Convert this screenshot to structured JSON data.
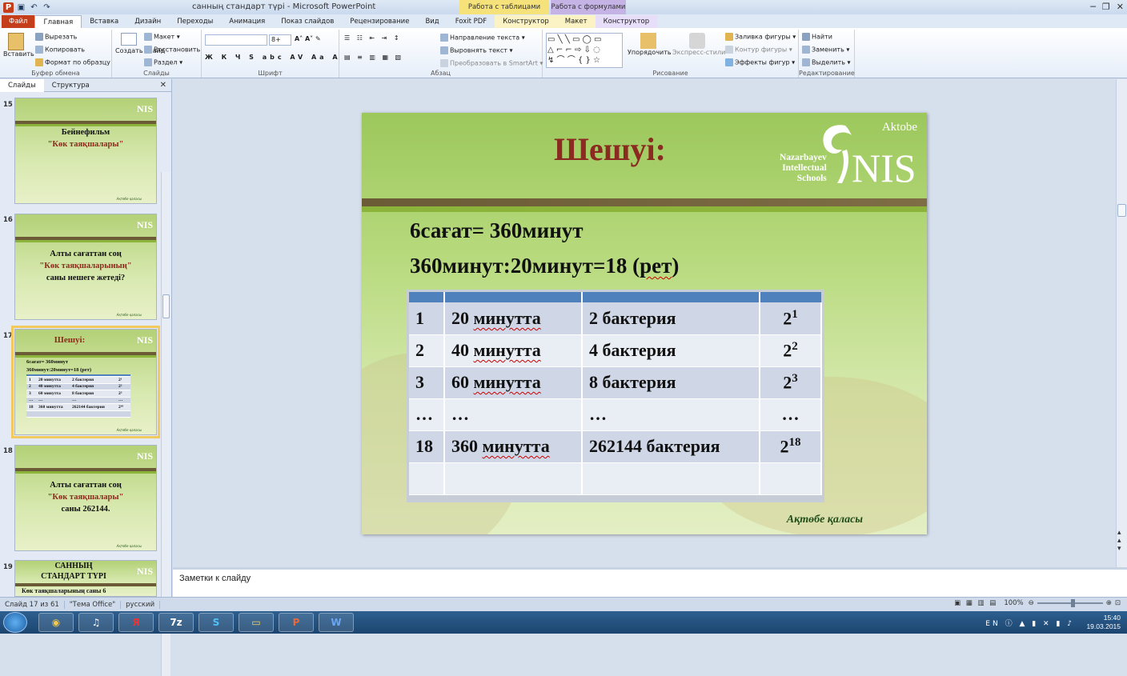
{
  "window": {
    "title": "санның стандарт түрі - Microsoft PowerPoint",
    "context_tab_1": "Работа с таблицами",
    "context_tab_2": "Работа с формулами"
  },
  "ribbon_tabs": [
    "Файл",
    "Главная",
    "Вставка",
    "Дизайн",
    "Переходы",
    "Анимация",
    "Показ слайдов",
    "Рецензирование",
    "Вид",
    "Foxit PDF",
    "Конструктор",
    "Макет",
    "Конструктор"
  ],
  "ribbon": {
    "clipboard": {
      "paste": "Вставить",
      "cut": "Вырезать",
      "copy": "Копировать",
      "format": "Формат по образцу",
      "label": "Буфер обмена"
    },
    "slides": {
      "new": "Создать слайд",
      "layout": "Макет",
      "reset": "Восстановить",
      "section": "Раздел",
      "label": "Слайды"
    },
    "font": {
      "size": "8+",
      "label": "Шрифт"
    },
    "paragraph": {
      "dir": "Направление текста",
      "align": "Выровнять текст",
      "smartart": "Преобразовать в SmartArt",
      "label": "Абзац"
    },
    "drawing": {
      "arrange": "Упорядочить",
      "styles": "Экспресс-стили",
      "fill": "Заливка фигуры",
      "outline": "Контур фигуры",
      "effects": "Эффекты фигур",
      "label": "Рисование"
    },
    "editing": {
      "find": "Найти",
      "replace": "Заменить",
      "select": "Выделить",
      "label": "Редактирование"
    }
  },
  "left_panel": {
    "tab_slides": "Слайды",
    "tab_outline": "Структура",
    "thumbs": [
      {
        "num": "15",
        "lines": [
          "Бейнефильм",
          "\"Көк таяқшалары\""
        ]
      },
      {
        "num": "16",
        "lines": [
          "Алты сағаттан соң",
          "\"Көк таяқшаларының\"",
          "саны нешеге жетеді?"
        ]
      },
      {
        "num": "17",
        "title": "Шешуі:"
      },
      {
        "num": "18",
        "lines": [
          "Алты сағаттан соң",
          "\"Көк таяқшалары\"",
          "саны  262144."
        ]
      },
      {
        "num": "19",
        "lines": [
          "САННЫҢ",
          "СТАНДАРТ  ТҮРІ",
          "Көк  таяқшаларының   саны  6"
        ]
      }
    ]
  },
  "slide": {
    "aktobe": "Aktobe",
    "title": "Шешуі:",
    "nis_words": [
      "Nazarbayev",
      "Intellectual",
      "Schools"
    ],
    "nis_logo": "NIS",
    "line1": "6сағат= 360минут",
    "line2_a": "360минут:20минут=18 (",
    "line2_b": "рет",
    "line2_c": ")",
    "table": [
      {
        "n": "1",
        "a": "20 ",
        "aw": "минутта",
        "b": "2 бактерия",
        "base": "2",
        "exp": "1"
      },
      {
        "n": "2",
        "a": "40 ",
        "aw": "минутта",
        "b": "4 бактерия",
        "base": "2",
        "exp": "2"
      },
      {
        "n": "3",
        "a": "60 ",
        "aw": "минутта",
        "b": "8 бактерия",
        "base": "2",
        "exp": "3"
      },
      {
        "n": "…",
        "a": "…",
        "aw": "",
        "b": "…",
        "base": "…",
        "exp": ""
      },
      {
        "n": "18",
        "a": "360 ",
        "aw": "минутта",
        "b": "262144 бактерия",
        "base": "2",
        "exp": "18"
      },
      {
        "n": "",
        "a": "",
        "aw": "",
        "b": "",
        "base": "",
        "exp": ""
      }
    ],
    "footer": "Ақтөбе қаласы",
    "thumb_mini": {
      "line1": "6сағат= 360минут",
      "line2": "360минут:20минут=18 (рет)",
      "rows": [
        [
          "1",
          "20 минутта",
          "2 бактерия",
          "2¹"
        ],
        [
          "2",
          "40 минутта",
          "4 бактерия",
          "2²"
        ],
        [
          "3",
          "60 минутта",
          "8 бактерия",
          "2³"
        ],
        [
          "…",
          "…",
          "…",
          "…"
        ],
        [
          "18",
          "360 минутта",
          "262144 бактерия",
          "2¹⁸"
        ]
      ]
    },
    "thumb_footer": "Ақтөбе қаласы"
  },
  "notes": {
    "placeholder": "Заметки к слайду"
  },
  "status": {
    "slide": "Слайд 17 из 61",
    "theme": "\"Тема Office\"",
    "lang": "русский",
    "zoom": "100%"
  },
  "taskbar": {
    "lang": "EN",
    "time": "15:40",
    "date": "19.03.2015"
  }
}
